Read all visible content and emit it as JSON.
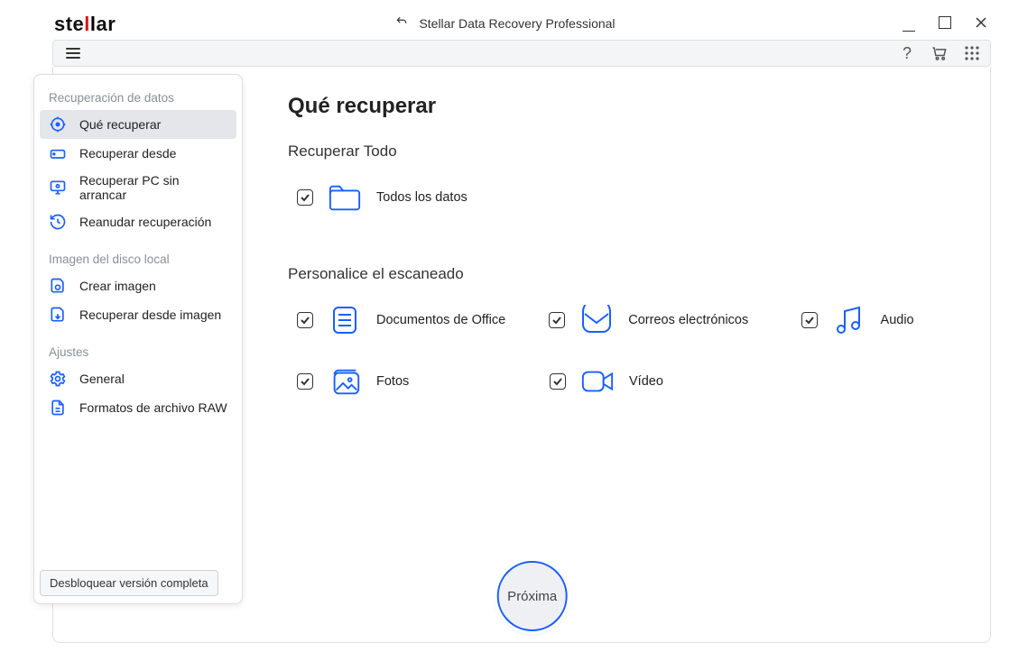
{
  "titlebar": {
    "app_title": "Stellar Data Recovery Professional"
  },
  "logo": {
    "pre": "ste",
    "l1": "l",
    "l2": "l",
    "post": "ar"
  },
  "sidebar": {
    "groups": [
      {
        "title": "Recuperación de datos",
        "items": [
          {
            "label": "Qué recuperar",
            "selected": true
          },
          {
            "label": "Recuperar desde"
          },
          {
            "label": "Recuperar PC sin arrancar"
          },
          {
            "label": "Reanudar recuperación"
          }
        ]
      },
      {
        "title": "Imagen del disco local",
        "items": [
          {
            "label": "Crear imagen"
          },
          {
            "label": "Recuperar desde imagen"
          }
        ]
      },
      {
        "title": "Ajustes",
        "items": [
          {
            "label": "General"
          },
          {
            "label": "Formatos de archivo RAW"
          }
        ]
      }
    ],
    "unlock": "Desbloquear versión completa"
  },
  "main": {
    "page_title": "Qué recuperar",
    "recover_all": {
      "title": "Recuperar Todo",
      "all_data": "Todos los datos"
    },
    "customize": {
      "title": "Personalice el escaneado",
      "office": "Documentos de Office",
      "emails": "Correos electrónicos",
      "audio": "Audio",
      "photos": "Fotos",
      "video": "Vídeo"
    }
  },
  "next_button": "Próxima"
}
